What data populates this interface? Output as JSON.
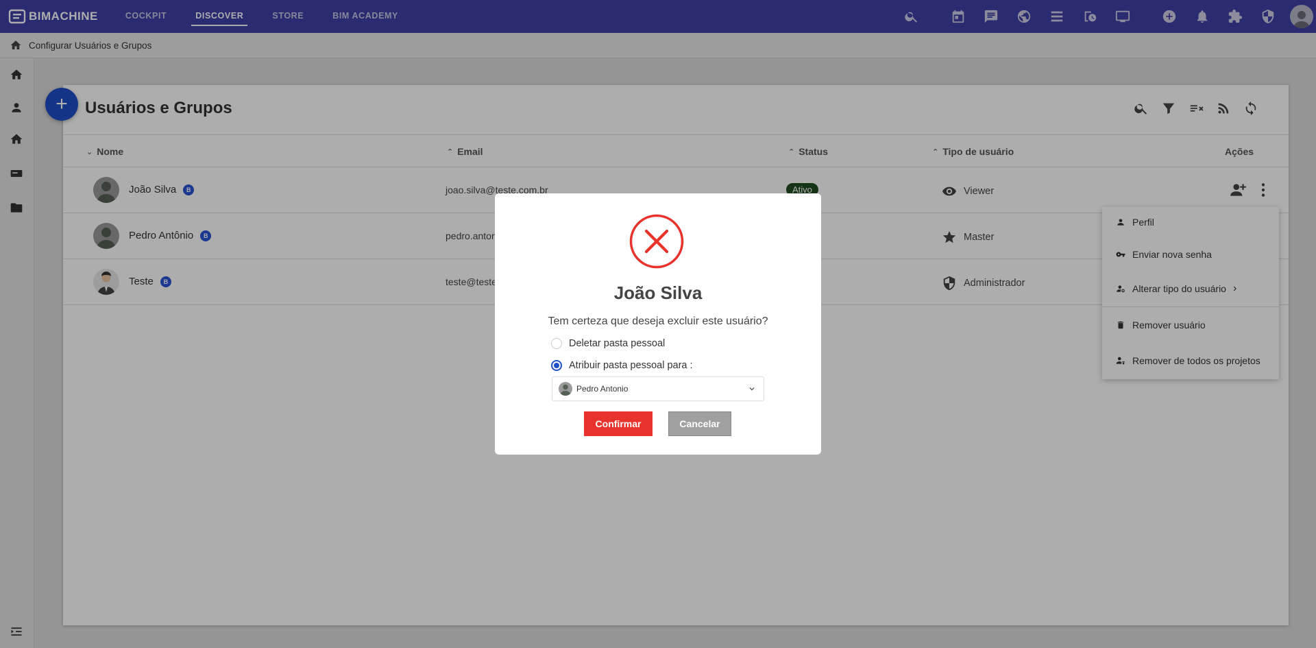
{
  "app": {
    "logo_text": "BIMACHINE"
  },
  "nav": {
    "items": [
      "COCKPIT",
      "DISCOVER",
      "STORE",
      "BIM ACADEMY"
    ],
    "active": "DISCOVER"
  },
  "top_icons": [
    "search-icon",
    "calendar-icon",
    "chat-icon",
    "globe-icon",
    "list-icon",
    "schedule-icon",
    "monitor-icon",
    "add-circle-icon",
    "bell-icon",
    "puzzle-icon",
    "shield-icon",
    "user-avatar"
  ],
  "breadcrumb": {
    "label": "Configurar Usuários e Grupos"
  },
  "page": {
    "title": "Usuários e Grupos",
    "fab_label": "+"
  },
  "table": {
    "headers": {
      "name": "Nome",
      "email": "Email",
      "status": "Status",
      "type": "Tipo de usuário",
      "actions": "Ações"
    },
    "rows": [
      {
        "name": "João Silva",
        "email": "joao.silva@teste.com.br",
        "status": "Ativo",
        "type": "Viewer",
        "type_icon": "eye-icon"
      },
      {
        "name": "Pedro Antônio",
        "email": "pedro.anton",
        "status": "",
        "type": "Master",
        "type_icon": "star-icon"
      },
      {
        "name": "Teste",
        "email": "teste@teste",
        "status": "",
        "type": "Administrador",
        "type_icon": "shield-icon"
      }
    ],
    "badge": "B"
  },
  "context_menu": {
    "items": [
      "Perfil",
      "Enviar nova senha",
      "Alterar tipo do usuário",
      "Remover usuário",
      "Remover de todos os projetos"
    ],
    "submenu_arrow": "›"
  },
  "modal": {
    "name": "João Silva",
    "question": "Tem certeza que deseja excluir este usuário?",
    "option_delete": "Deletar pasta pessoal",
    "option_assign": "Atribuir pasta pessoal para :",
    "selected_option": "assign",
    "assign_to": "Pedro Antonio",
    "confirm_label": "Confirmar",
    "cancel_label": "Cancelar",
    "accent_color": "#e8322c"
  }
}
